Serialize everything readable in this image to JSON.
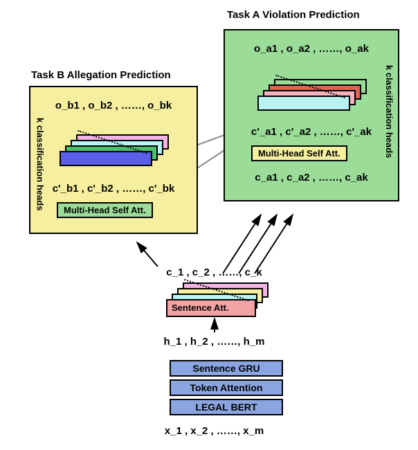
{
  "titles": {
    "taskA": "Task A Violation Prediction",
    "taskB": "Task B Allegation Prediction"
  },
  "taskA": {
    "outputs_row": "o_a1 , o_a2 , ……, o_ak",
    "cprime_row": "c'_a1 , c'_a2 , ……, c'_ak",
    "c_row": "c_a1 , c_a2 , ……, c_ak",
    "mhsa": "Multi-Head Self Att.",
    "side": "k classification heads"
  },
  "taskB": {
    "outputs_row": "o_b1 , o_b2 , ……, o_bk",
    "cprime_row": "c'_b1 , c'_b2 , ……, c'_bk",
    "mhsa": "Multi-Head Self Att.",
    "side": "k classification heads"
  },
  "middle": {
    "c_row": "c_1 , c_2 , ……, c_k",
    "h_row": "h_1 , h_2 , ……, h_m",
    "sent_att": "Sentence Att."
  },
  "encoders": {
    "gru": "Sentence GRU",
    "tok": "Token Attention",
    "bert": "LEGAL BERT"
  },
  "bottom": {
    "x_row": "x_1 , x_2 , ……, x_m"
  }
}
